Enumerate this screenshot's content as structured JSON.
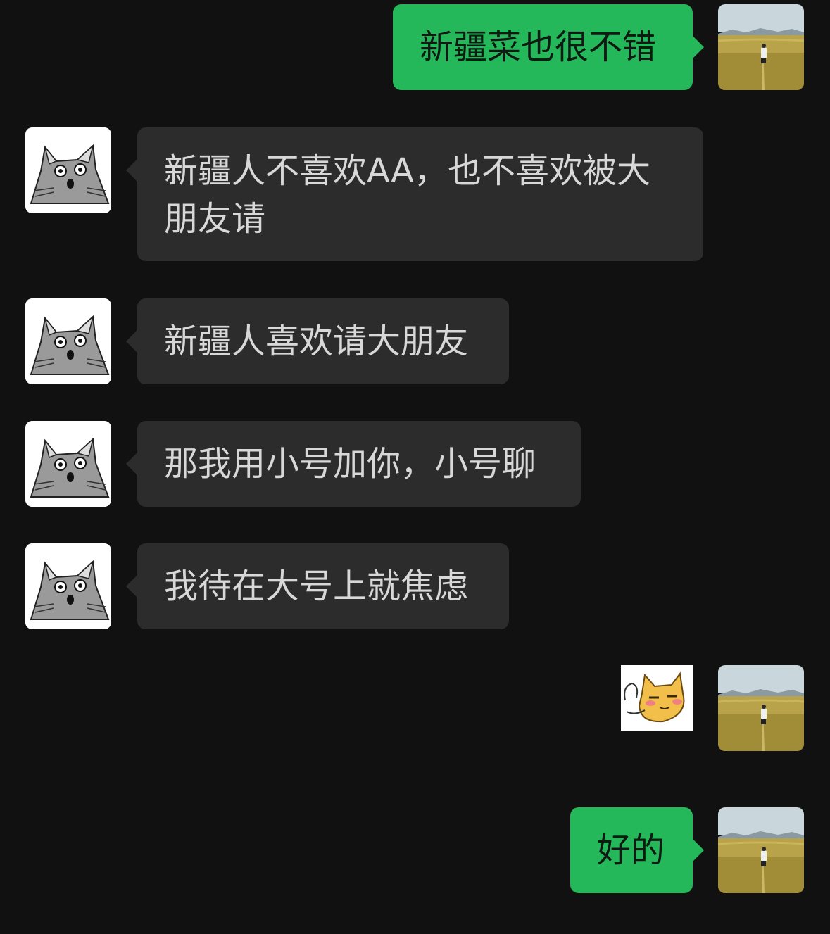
{
  "messages": [
    {
      "side": "me",
      "text": "新疆菜也很不错"
    },
    {
      "side": "them",
      "text": "新疆人不喜欢AA，也不喜欢被大朋友请"
    },
    {
      "side": "them",
      "text": "新疆人喜欢请大朋友"
    },
    {
      "side": "them",
      "text": "那我用小号加你，小号聊"
    },
    {
      "side": "them",
      "text": "我待在大号上就焦虑"
    },
    {
      "side": "me",
      "type": "sticker",
      "icon": "cat-emoji-sticker"
    },
    {
      "side": "me",
      "text": "好的"
    }
  ],
  "colors": {
    "background": "#111111",
    "bubble_them": "#2c2c2c",
    "bubble_me": "#25b85a"
  }
}
